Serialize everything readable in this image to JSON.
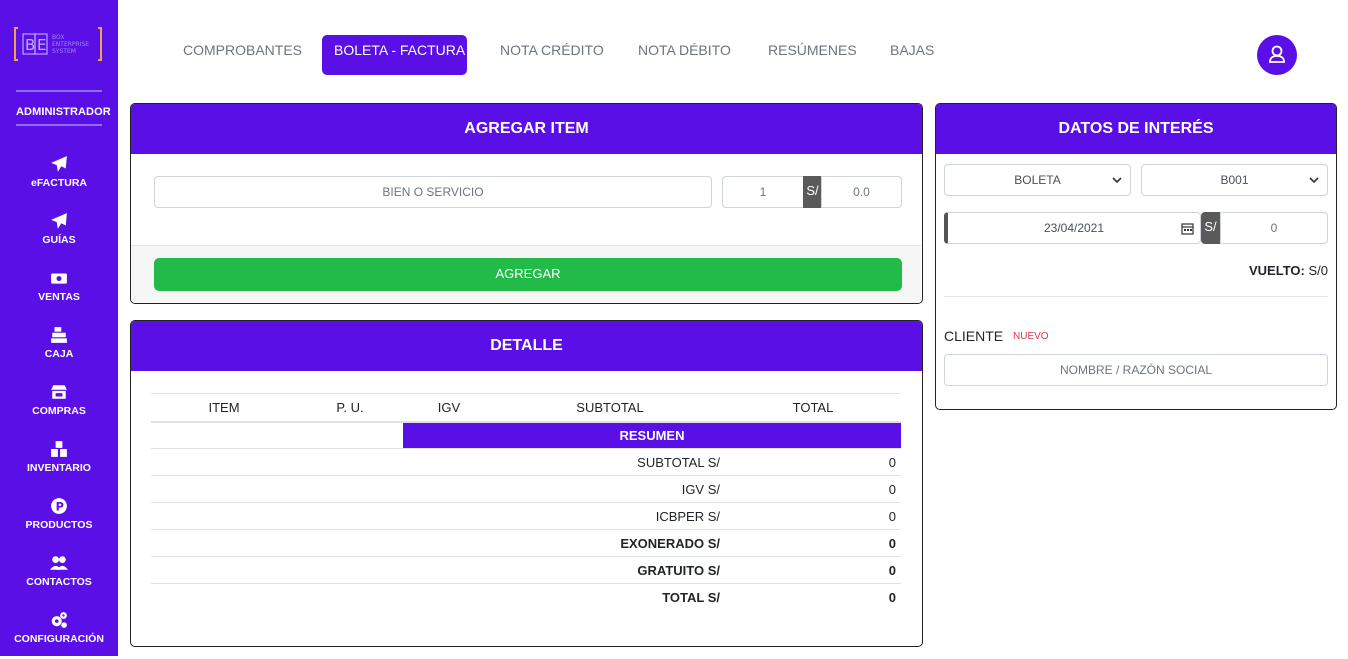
{
  "brand": {
    "logo_text": "BOX ENTERPRISE SYSTEM",
    "logo_letters": "BE"
  },
  "sidebar": {
    "role": "ADMINISTRADOR",
    "items": [
      {
        "label": "eFACTURA",
        "icon": "paper-plane-icon"
      },
      {
        "label": "GUÍAS",
        "icon": "paper-plane-icon"
      },
      {
        "label": "VENTAS",
        "icon": "money-bill-icon"
      },
      {
        "label": "CAJA",
        "icon": "cash-register-icon"
      },
      {
        "label": "COMPRAS",
        "icon": "store-icon"
      },
      {
        "label": "INVENTARIO",
        "icon": "boxes-icon"
      },
      {
        "label": "PRODUCTOS",
        "icon": "product-icon"
      },
      {
        "label": "CONTACTOS",
        "icon": "users-icon"
      },
      {
        "label": "CONFIGURACIÓN",
        "icon": "cogs-icon"
      }
    ]
  },
  "tabs": [
    {
      "label": "COMPROBANTES"
    },
    {
      "label": "BOLETA - FACTURA",
      "active": true
    },
    {
      "label": "NOTA CRÉDITO"
    },
    {
      "label": "NOTA DÉBITO"
    },
    {
      "label": "RESÚMENES"
    },
    {
      "label": "BAJAS"
    }
  ],
  "agregar": {
    "title": "AGREGAR ITEM",
    "item_placeholder": "BIEN O SERVICIO",
    "quantity": "1",
    "currency": "S/",
    "price_placeholder": "0.0",
    "button": "AGREGAR"
  },
  "detalle": {
    "title": "DETALLE",
    "columns": [
      "ITEM",
      "P. U.",
      "IGV",
      "SUBTOTAL",
      "TOTAL"
    ],
    "resumen_label": "RESUMEN",
    "summary": [
      {
        "label": "SUBTOTAL S/",
        "value": "0",
        "bold": false
      },
      {
        "label": "IGV S/",
        "value": "0",
        "bold": false
      },
      {
        "label": "ICBPER S/",
        "value": "0",
        "bold": false
      },
      {
        "label": "EXONERADO S/",
        "value": "0",
        "bold": true
      },
      {
        "label": "GRATUITO S/",
        "value": "0",
        "bold": true
      },
      {
        "label": "TOTAL S/",
        "value": "0",
        "bold": true
      }
    ]
  },
  "datos": {
    "title": "DATOS DE INTERÉS",
    "doc_type": "BOLETA",
    "serie": "B001",
    "date": "23/04/2021",
    "currency": "S/",
    "amount_placeholder": "0",
    "vuelto_label": "VUELTO:",
    "vuelto_value": "S/0",
    "cliente_label": "CLIENTE",
    "nuevo_label": "NUEVO",
    "cliente_placeholder": "NOMBRE / RAZÓN SOCIAL"
  },
  "colors": {
    "primary": "#5a0fe6",
    "success": "#22bb4a",
    "danger": "#dc3545"
  }
}
